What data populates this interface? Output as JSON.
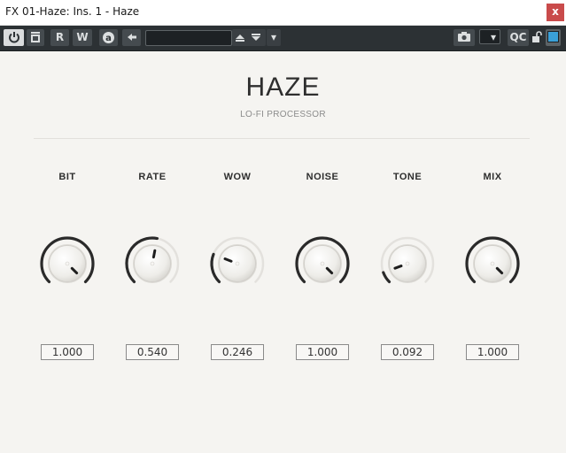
{
  "window": {
    "title": "FX 01-Haze: Ins. 1 - Haze",
    "close_label": "x"
  },
  "toolbar": {
    "read_label": "R",
    "write_label": "W",
    "auto_label": "a",
    "preset_value": "",
    "preset_dropdown_label": "▾",
    "camera_dropdown_label": "▾",
    "qc_label": "QC",
    "colors": {
      "background": "#2c3134",
      "button": "#454b4f",
      "active": "#dadcdd",
      "accent": "#3aa0d8"
    }
  },
  "plugin": {
    "title": "HAZE",
    "subtitle": "LO-FI PROCESSOR",
    "arc_color": "#2a2a2a",
    "track_color": "#e3e1dd",
    "knobs": [
      {
        "id": "bit",
        "label": "BIT",
        "value": "1.000",
        "fraction": 1.0
      },
      {
        "id": "rate",
        "label": "RATE",
        "value": "0.540",
        "fraction": 0.54
      },
      {
        "id": "wow",
        "label": "WOW",
        "value": "0.246",
        "fraction": 0.246
      },
      {
        "id": "noise",
        "label": "NOISE",
        "value": "1.000",
        "fraction": 1.0
      },
      {
        "id": "tone",
        "label": "TONE",
        "value": "0.092",
        "fraction": 0.092
      },
      {
        "id": "mix",
        "label": "MIX",
        "value": "1.000",
        "fraction": 1.0
      }
    ]
  }
}
